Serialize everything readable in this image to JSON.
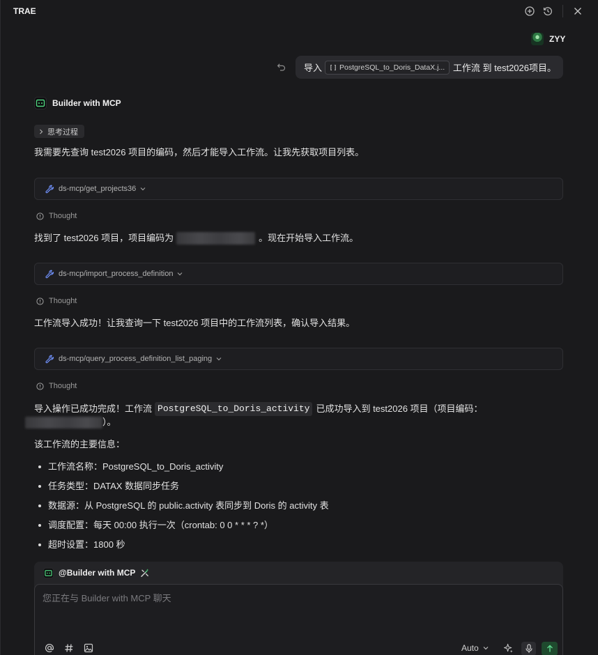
{
  "app": {
    "title": "TRAE"
  },
  "icons": {
    "title_bar": [
      "new-chat-icon",
      "history-icon",
      "close-icon"
    ],
    "composer": [
      "mention-icon",
      "hashtag-icon",
      "image-icon",
      "sparkle-icon",
      "microphone-icon",
      "send-icon"
    ]
  },
  "user": {
    "name": "ZYY"
  },
  "user_message": {
    "prefix": "导入",
    "attachment": "PostgreSQL_to_Doris_DataX.j...",
    "suffix": "工作流 到 test2026项目。"
  },
  "agent": {
    "name": "Builder with MCP"
  },
  "thinking": {
    "label": "思考过程"
  },
  "conversation": {
    "intro": "我需要先查询 test2026 项目的编码，然后才能导入工作流。让我先获取项目列表。",
    "steps": [
      {
        "tool": "ds-mcp/get_projects36",
        "thought": "Thought"
      },
      {
        "tool": "ds-mcp/import_process_definition",
        "thought": "Thought"
      },
      {
        "tool": "ds-mcp/query_process_definition_list_paging",
        "thought": "Thought"
      }
    ],
    "found": {
      "before": "找到了 test2026 项目，项目编码为",
      "after": "。现在开始导入工作流。"
    },
    "imported": "工作流导入成功！让我查询一下 test2026 项目中的工作流列表，确认导入结果。",
    "summary": {
      "before": "导入操作已成功完成！工作流",
      "workflow": "PostgreSQL_to_Doris_activity",
      "after": "已成功导入到 test2026 项目（项目编码：",
      "close": "）。"
    },
    "details_heading": "该工作流的主要信息：",
    "details": [
      "工作流名称：PostgreSQL_to_Doris_activity",
      "任务类型：DATAX 数据同步任务",
      "数据源：从 PostgreSQL 的 public.activity 表同步到 Doris 的 activity 表",
      "调度配置：每天 00:00 执行一次（crontab: 0 0 * * * ? *）",
      "超时设置：1800 秒"
    ]
  },
  "composer": {
    "mention": "@Builder with MCP",
    "placeholder": "您正在与 Builder with MCP 聊天",
    "mode": "Auto"
  },
  "theme": {
    "background": "#1a1a1c",
    "accent_green": "#4fd37e",
    "tool_icon_blue": "#6f8ff7",
    "send_button": "#1f4a2e"
  }
}
